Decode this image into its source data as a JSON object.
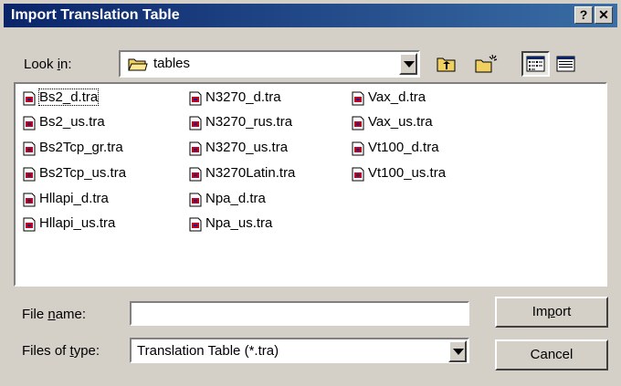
{
  "window": {
    "title": "Import Translation Table",
    "help_glyph": "?",
    "close_glyph": "✕"
  },
  "look_in": {
    "label_prefix": "Look ",
    "label_accel": "i",
    "label_suffix": "n:",
    "value": "tables",
    "icon": "folder-icon"
  },
  "toolbar": {
    "up_icon": "up-one-level-icon",
    "new_folder_icon": "new-folder-icon",
    "list_icon": "list-view-icon",
    "details_icon": "details-view-icon"
  },
  "files": [
    {
      "name": "Bs2_d.tra",
      "focused": true
    },
    {
      "name": "Bs2_us.tra"
    },
    {
      "name": "Bs2Tcp_gr.tra"
    },
    {
      "name": "Bs2Tcp_us.tra"
    },
    {
      "name": "Hllapi_d.tra"
    },
    {
      "name": "Hllapi_us.tra"
    },
    {
      "name": "N3270_d.tra"
    },
    {
      "name": "N3270_rus.tra"
    },
    {
      "name": "N3270_us.tra"
    },
    {
      "name": "N3270Latin.tra"
    },
    {
      "name": "Npa_d.tra"
    },
    {
      "name": "Npa_us.tra"
    },
    {
      "name": "Vax_d.tra"
    },
    {
      "name": "Vax_us.tra"
    },
    {
      "name": "Vt100_d.tra"
    },
    {
      "name": "Vt100_us.tra"
    }
  ],
  "file_name": {
    "label_prefix": "File ",
    "label_accel": "n",
    "label_suffix": "ame:",
    "value": ""
  },
  "file_type": {
    "label_prefix": "Files of ",
    "label_accel": "t",
    "label_suffix": "ype:",
    "value": "Translation Table (*.tra)"
  },
  "buttons": {
    "import_prefix": "Im",
    "import_accel": "p",
    "import_suffix": "ort",
    "cancel": "Cancel"
  },
  "colors": {
    "title_bar": "#0a246a",
    "face": "#d4d0c8",
    "folder": "#f0d060"
  }
}
